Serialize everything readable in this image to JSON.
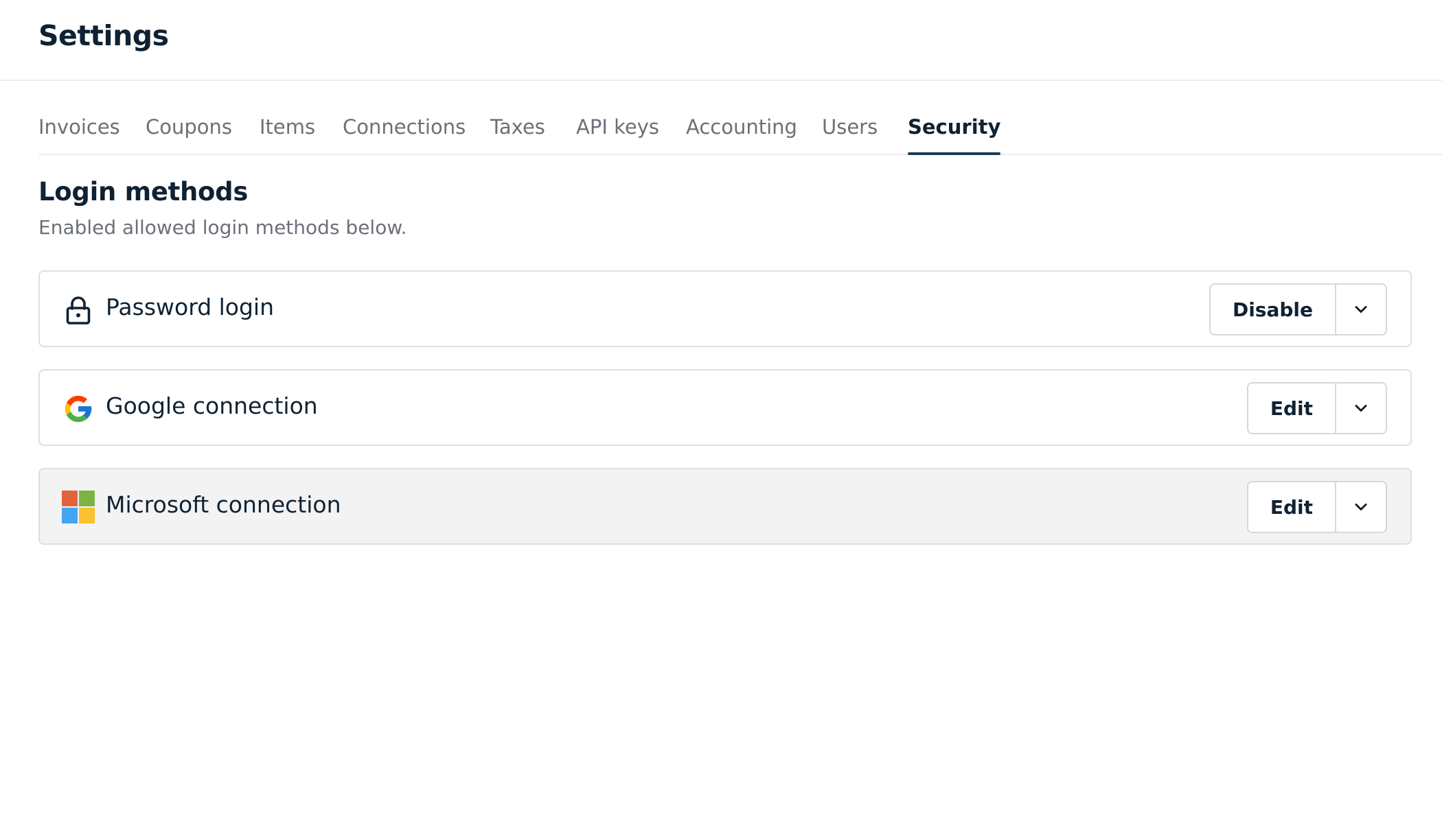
{
  "header": {
    "title": "Settings"
  },
  "tabs": [
    {
      "label": "Invoices",
      "active": false
    },
    {
      "label": "Coupons",
      "active": false
    },
    {
      "label": "Items",
      "active": false
    },
    {
      "label": "Connections",
      "active": false
    },
    {
      "label": "Taxes",
      "active": false
    },
    {
      "label": "API keys",
      "active": false
    },
    {
      "label": "Accounting",
      "active": false
    },
    {
      "label": "Users",
      "active": false
    },
    {
      "label": "Security",
      "active": true
    }
  ],
  "section": {
    "title": "Login methods",
    "subtitle": "Enabled allowed login methods below."
  },
  "methods": [
    {
      "label": "Password login",
      "icon": "lock-icon",
      "action": "Disable"
    },
    {
      "label": "Google connection",
      "icon": "google-icon",
      "action": "Edit"
    },
    {
      "label": "Microsoft connection",
      "icon": "microsoft-icon",
      "action": "Edit"
    }
  ],
  "colors": {
    "text": "#0f2233",
    "muted": "#6b7078",
    "active_tab_underline": "#1c3d55",
    "border": "#dcdfe2",
    "hover_row": "#f3f3f3",
    "ms_red": "#e2633a",
    "ms_green": "#7cb342",
    "ms_blue": "#42a5f5",
    "ms_yellow": "#fbc02d"
  }
}
